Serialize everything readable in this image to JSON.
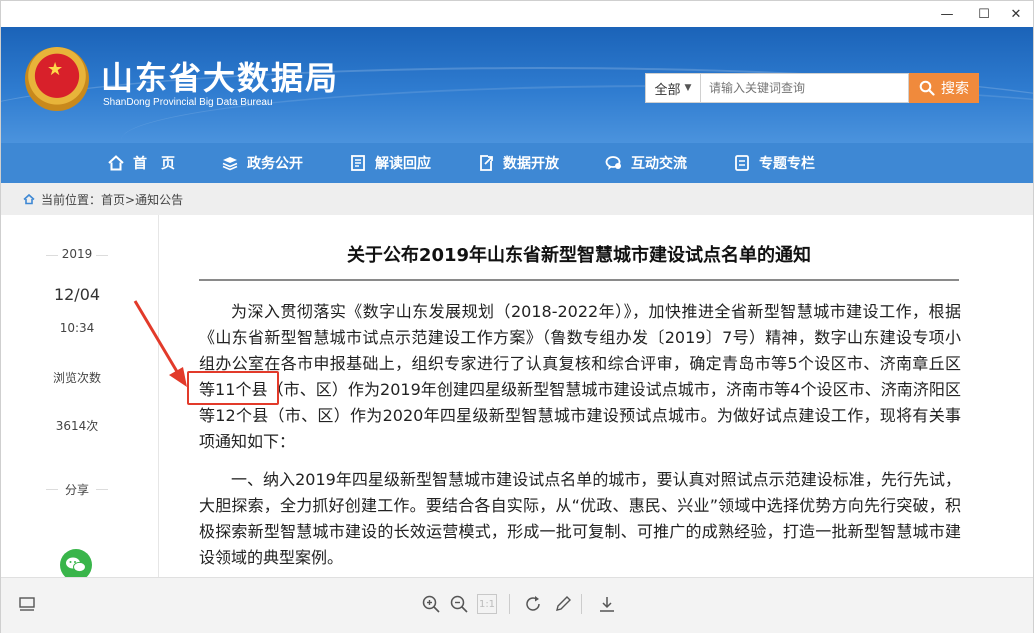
{
  "window": {
    "controls": {
      "minimize": "—",
      "maximize": "☐",
      "close": "✕"
    }
  },
  "header": {
    "title": "山东省大数据局",
    "subtitle": "ShanDong Provincial Big Data Bureau",
    "search": {
      "scope": "全部",
      "placeholder": "请输入关键词查询",
      "button_label": "搜索"
    }
  },
  "nav": {
    "items": [
      {
        "label": "首　页",
        "icon": "home-icon"
      },
      {
        "label": "政务公开",
        "icon": "layers-icon"
      },
      {
        "label": "解读回应",
        "icon": "document-icon"
      },
      {
        "label": "数据开放",
        "icon": "export-icon"
      },
      {
        "label": "互动交流",
        "icon": "chat-icon"
      },
      {
        "label": "专题专栏",
        "icon": "list-icon"
      }
    ]
  },
  "breadcrumb": {
    "prefix": "当前位置：",
    "path": "首页>通知公告"
  },
  "sidebar": {
    "year": "2019",
    "date": "12/04",
    "time": "10:34",
    "views_label": "浏览次数",
    "views": "3614次",
    "share_label": "分享"
  },
  "article": {
    "title": "关于公布2019年山东省新型智慧城市建设试点名单的通知",
    "paragraphs": [
      "为深入贯彻落实《数字山东发展规划（2018-2022年）》，加快推进全省新型智慧城市建设工作，根据《山东省新型智慧城市试点示范建设工作方案》（鲁数专组办发〔2019〕7号）精神，数字山东建设专项小组办公室在各市申报基础上，组织专家进行了认真复核和综合评审，确定青岛市等5个设区市、济南章丘区等11个县（市、区）作为2019年创建四星级新型智慧城市建设试点城市，济南市等4个设区市、济南济阳区等12个县（市、区）作为2020年四星级新型智慧城市建设预试点城市。为做好试点建设工作，现将有关事项通知如下：",
      "一、纳入2019年四星级新型智慧城市建设试点名单的城市，要认真对照试点示范建设标准，先行先试，大胆探索，全力抓好创建工作。要结合各自实际，从“优政、惠民、兴业”领域中选择优势方向先行突破，积极探索新型智慧城市建设的长效运营模式，形成一批可复制、可推广的成熟经验，打造一批新型智慧城市建设领域的典型案例。"
    ]
  },
  "toolbar": {
    "page_box": "1:1"
  },
  "colors": {
    "header_blue": "#2f7cd0",
    "nav_blue": "#3e88d4",
    "search_orange": "#f08a3c",
    "annotation_red": "#e23a2a",
    "wechat_green": "#39b54a"
  }
}
